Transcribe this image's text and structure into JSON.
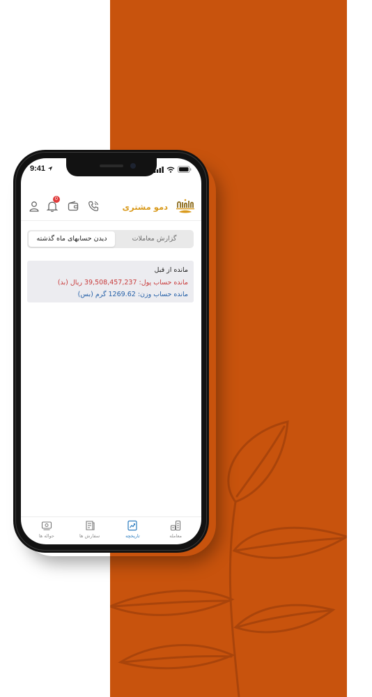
{
  "status_bar": {
    "time": "9:41"
  },
  "header": {
    "brand_name": "دمو مشتری",
    "notification_count": "0",
    "icons": [
      "user-icon",
      "bell-icon",
      "wallet-icon",
      "phone-icon",
      "brand-logo"
    ]
  },
  "tabs": [
    {
      "label": "دیدن حسابهای ماه گذشته",
      "active": true
    },
    {
      "label": "گزارش معاملات",
      "active": false
    }
  ],
  "balance_card": {
    "title": "مانده از قبل",
    "money_line": "مانده حساب پول: 39,508,457,237 ریال (بد)",
    "weight_line": "مانده حساب وزن: 1269.62 گرم (بس)"
  },
  "bottom_nav": [
    {
      "label": "معامله",
      "icon": "trade-icon",
      "active": false
    },
    {
      "label": "تاریخچه",
      "icon": "history-icon",
      "active": true
    },
    {
      "label": "سفارش ها",
      "icon": "orders-icon",
      "active": false
    },
    {
      "label": "حواله ها",
      "icon": "remittance-icon",
      "active": false
    }
  ],
  "colors": {
    "background_band": "#c8530d",
    "brand_gold": "#d99a1c",
    "money_red": "#c83a3a",
    "weight_blue": "#2560a8",
    "active_nav": "#2a7bbf"
  }
}
